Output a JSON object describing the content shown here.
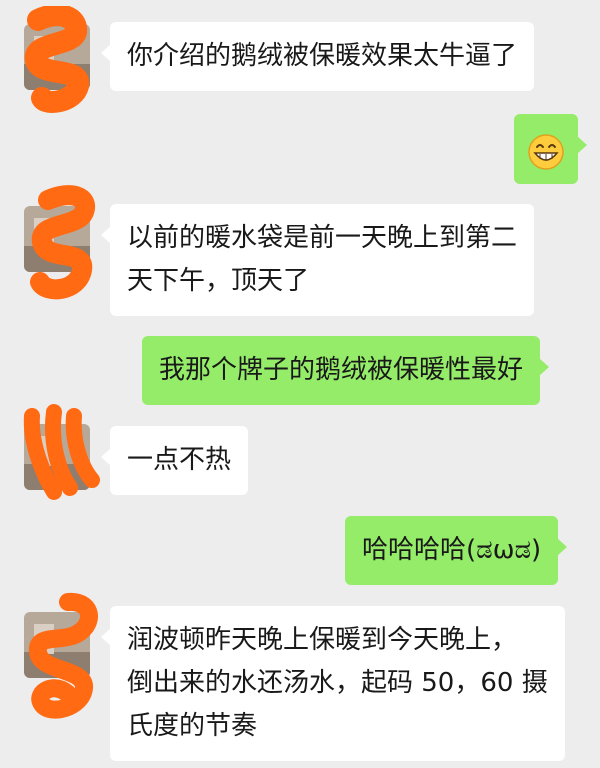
{
  "chat": {
    "messages": [
      {
        "side": "in",
        "lines": [
          "你介绍的鹅绒被保暖效果太牛逼了"
        ]
      },
      {
        "side": "out",
        "emoji": "grinning-face-icon"
      },
      {
        "side": "in",
        "lines": [
          "以前的暖水袋是前一天晚上到第二",
          "天下午，顶天了"
        ]
      },
      {
        "side": "out",
        "lines": [
          "我那个牌子的鹅绒被保暖性最好"
        ]
      },
      {
        "side": "in",
        "lines": [
          "一点不热"
        ]
      },
      {
        "side": "out",
        "lines": [
          "哈哈哈哈(ಡωಡ)"
        ]
      },
      {
        "side": "in",
        "lines": [
          "润波顿昨天晚上保暖到今天晚上，",
          "倒出来的水还汤水，起码 50，60 摄",
          "氏度的节奏"
        ]
      }
    ]
  },
  "colors": {
    "background": "#ededed",
    "incoming_bubble": "#ffffff",
    "outgoing_bubble": "#95ec69",
    "redaction": "#ff6a13"
  }
}
